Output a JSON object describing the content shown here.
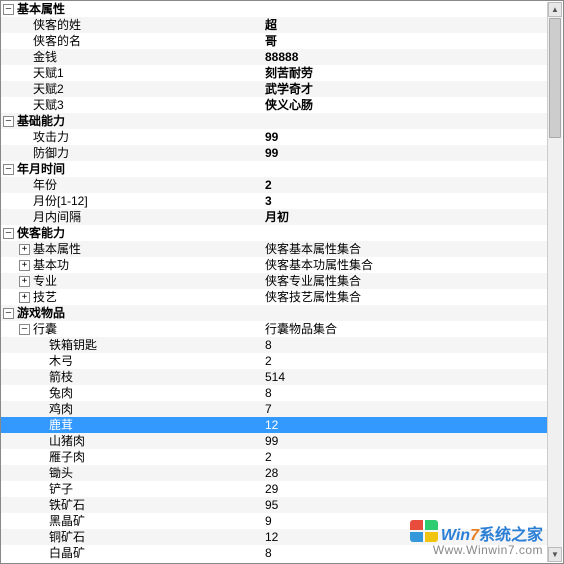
{
  "valueColumnLeft": 264,
  "rows": [
    {
      "depth": 0,
      "expander": "–",
      "bold": true,
      "label": "基本属性",
      "value": "",
      "stripe": false
    },
    {
      "depth": 1,
      "expander": "",
      "bold": false,
      "label": "侠客的姓",
      "value": "超",
      "valBold": true,
      "stripe": true
    },
    {
      "depth": 1,
      "expander": "",
      "bold": false,
      "label": "侠客的名",
      "value": "哥",
      "valBold": true,
      "stripe": false
    },
    {
      "depth": 1,
      "expander": "",
      "bold": false,
      "label": "金钱",
      "value": "88888",
      "valBold": true,
      "stripe": true
    },
    {
      "depth": 1,
      "expander": "",
      "bold": false,
      "label": "天赋1",
      "value": "刻苦耐劳",
      "valBold": true,
      "stripe": false
    },
    {
      "depth": 1,
      "expander": "",
      "bold": false,
      "label": "天赋2",
      "value": "武学奇才",
      "valBold": true,
      "stripe": true
    },
    {
      "depth": 1,
      "expander": "",
      "bold": false,
      "label": "天赋3",
      "value": "侠义心肠",
      "valBold": true,
      "stripe": false
    },
    {
      "depth": 0,
      "expander": "–",
      "bold": true,
      "label": "基础能力",
      "value": "",
      "stripe": true
    },
    {
      "depth": 1,
      "expander": "",
      "bold": false,
      "label": "攻击力",
      "value": "99",
      "valBold": true,
      "stripe": false
    },
    {
      "depth": 1,
      "expander": "",
      "bold": false,
      "label": "防御力",
      "value": "99",
      "valBold": true,
      "stripe": true
    },
    {
      "depth": 0,
      "expander": "–",
      "bold": true,
      "label": "年月时间",
      "value": "",
      "stripe": false
    },
    {
      "depth": 1,
      "expander": "",
      "bold": false,
      "label": "年份",
      "value": "2",
      "valBold": true,
      "stripe": true
    },
    {
      "depth": 1,
      "expander": "",
      "bold": false,
      "label": "月份[1-12]",
      "value": "3",
      "valBold": true,
      "stripe": false
    },
    {
      "depth": 1,
      "expander": "",
      "bold": false,
      "label": "月内间隔",
      "value": "月初",
      "valBold": true,
      "stripe": true
    },
    {
      "depth": 0,
      "expander": "–",
      "bold": true,
      "label": "侠客能力",
      "value": "",
      "stripe": false
    },
    {
      "depth": 1,
      "expander": "+",
      "bold": false,
      "label": "基本属性",
      "value": "侠客基本属性集合",
      "valBold": false,
      "stripe": true
    },
    {
      "depth": 1,
      "expander": "+",
      "bold": false,
      "label": "基本功",
      "value": "侠客基本功属性集合",
      "valBold": false,
      "stripe": false
    },
    {
      "depth": 1,
      "expander": "+",
      "bold": false,
      "label": "专业",
      "value": "侠客专业属性集合",
      "valBold": false,
      "stripe": true
    },
    {
      "depth": 1,
      "expander": "+",
      "bold": false,
      "label": "技艺",
      "value": "侠客技艺属性集合",
      "valBold": false,
      "stripe": false
    },
    {
      "depth": 0,
      "expander": "–",
      "bold": true,
      "label": "游戏物品",
      "value": "",
      "stripe": true
    },
    {
      "depth": 1,
      "expander": "–",
      "bold": false,
      "label": "行囊",
      "value": "行囊物品集合",
      "valBold": false,
      "stripe": false
    },
    {
      "depth": 2,
      "expander": "",
      "bold": false,
      "label": "铁箱钥匙",
      "value": "8",
      "valBold": false,
      "stripe": true
    },
    {
      "depth": 2,
      "expander": "",
      "bold": false,
      "label": "木弓",
      "value": "2",
      "valBold": false,
      "stripe": false
    },
    {
      "depth": 2,
      "expander": "",
      "bold": false,
      "label": "箭枝",
      "value": "514",
      "valBold": false,
      "stripe": true
    },
    {
      "depth": 2,
      "expander": "",
      "bold": false,
      "label": "兔肉",
      "value": "8",
      "valBold": false,
      "stripe": false
    },
    {
      "depth": 2,
      "expander": "",
      "bold": false,
      "label": "鸡肉",
      "value": "7",
      "valBold": false,
      "stripe": true
    },
    {
      "depth": 2,
      "expander": "",
      "bold": false,
      "label": "鹿茸",
      "value": "12",
      "valBold": false,
      "stripe": false,
      "selected": true
    },
    {
      "depth": 2,
      "expander": "",
      "bold": false,
      "label": "山猪肉",
      "value": "99",
      "valBold": false,
      "stripe": true
    },
    {
      "depth": 2,
      "expander": "",
      "bold": false,
      "label": "雁子肉",
      "value": "2",
      "valBold": false,
      "stripe": false
    },
    {
      "depth": 2,
      "expander": "",
      "bold": false,
      "label": "锄头",
      "value": "28",
      "valBold": false,
      "stripe": true
    },
    {
      "depth": 2,
      "expander": "",
      "bold": false,
      "label": "铲子",
      "value": "29",
      "valBold": false,
      "stripe": false
    },
    {
      "depth": 2,
      "expander": "",
      "bold": false,
      "label": "铁矿石",
      "value": "95",
      "valBold": false,
      "stripe": true
    },
    {
      "depth": 2,
      "expander": "",
      "bold": false,
      "label": "黑晶矿",
      "value": "9",
      "valBold": false,
      "stripe": false
    },
    {
      "depth": 2,
      "expander": "",
      "bold": false,
      "label": "铜矿石",
      "value": "12",
      "valBold": false,
      "stripe": true
    },
    {
      "depth": 2,
      "expander": "",
      "bold": false,
      "label": "白晶矿",
      "value": "8",
      "valBold": false,
      "stripe": false
    }
  ],
  "watermark": {
    "brand_win": "Win",
    "brand_seven": "7",
    "brand_cn": "系统之家",
    "url": "Www.Winwin7.com"
  }
}
